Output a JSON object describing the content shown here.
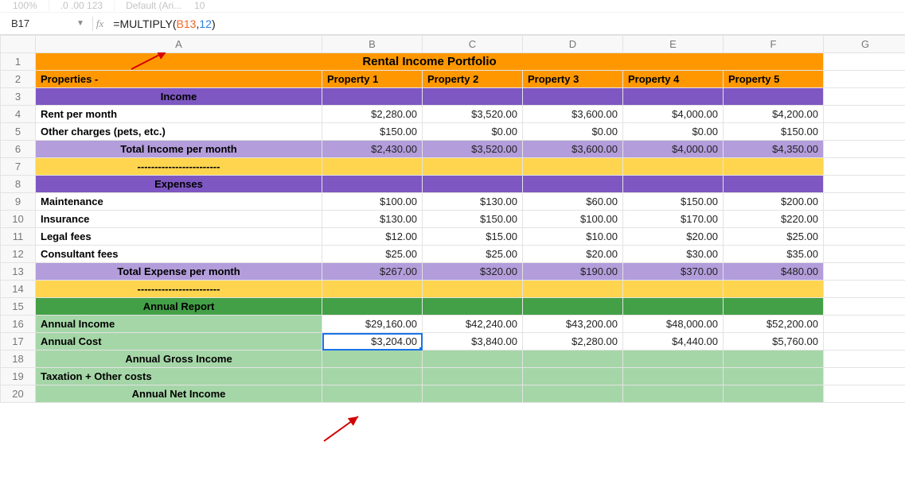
{
  "toolbar": {
    "zoom": "100%",
    "font": "Default (Ari...",
    "fontsize": "10",
    "format_hint": ".0 .00 123"
  },
  "namebox": "B17",
  "formula": {
    "prefix": "=",
    "fn": "MULTIPLY",
    "open": "(",
    "ref": "B13",
    "comma": ",",
    "num": "12",
    "close": ")"
  },
  "columns": [
    "A",
    "B",
    "C",
    "D",
    "E",
    "F",
    "G"
  ],
  "rows_count": 20,
  "data": {
    "title": "Rental Income Portfolio",
    "props_label": "Properties -",
    "props": [
      "Property 1",
      "Property 2",
      "Property 3",
      "Property 4",
      "Property 5"
    ],
    "income_hdr": "Income",
    "r4": {
      "label": "Rent per month",
      "v": [
        "$2,280.00",
        "$3,520.00",
        "$3,600.00",
        "$4,000.00",
        "$4,200.00"
      ]
    },
    "r5": {
      "label": "Other charges (pets, etc.)",
      "v": [
        "$150.00",
        "$0.00",
        "$0.00",
        "$0.00",
        "$150.00"
      ]
    },
    "r6": {
      "label": "Total Income per month",
      "v": [
        "$2,430.00",
        "$3,520.00",
        "$3,600.00",
        "$4,000.00",
        "$4,350.00"
      ]
    },
    "dashes": "------------------------",
    "expenses_hdr": "Expenses",
    "r9": {
      "label": "Maintenance",
      "v": [
        "$100.00",
        "$130.00",
        "$60.00",
        "$150.00",
        "$200.00"
      ]
    },
    "r10": {
      "label": "Insurance",
      "v": [
        "$130.00",
        "$150.00",
        "$100.00",
        "$170.00",
        "$220.00"
      ]
    },
    "r11": {
      "label": "Legal fees",
      "v": [
        "$12.00",
        "$15.00",
        "$10.00",
        "$20.00",
        "$25.00"
      ]
    },
    "r12": {
      "label": "Consultant fees",
      "v": [
        "$25.00",
        "$25.00",
        "$20.00",
        "$30.00",
        "$35.00"
      ]
    },
    "r13": {
      "label": "Total Expense per month",
      "v": [
        "$267.00",
        "$320.00",
        "$190.00",
        "$370.00",
        "$480.00"
      ]
    },
    "annual_hdr": "Annual Report",
    "r16": {
      "label": "Annual Income",
      "v": [
        "$29,160.00",
        "$42,240.00",
        "$43,200.00",
        "$48,000.00",
        "$52,200.00"
      ]
    },
    "r17": {
      "label": "Annual Cost",
      "v": [
        "$3,204.00",
        "$3,840.00",
        "$2,280.00",
        "$4,440.00",
        "$5,760.00"
      ]
    },
    "r18": {
      "label": "Annual Gross Income"
    },
    "r19": {
      "label": "Taxation + Other costs"
    },
    "r20": {
      "label": "Annual Net Income"
    }
  },
  "active_cell": "B17",
  "chart_data": {
    "type": "table",
    "title": "Rental Income Portfolio",
    "categories": [
      "Property 1",
      "Property 2",
      "Property 3",
      "Property 4",
      "Property 5"
    ],
    "series": [
      {
        "name": "Rent per month",
        "values": [
          2280,
          3520,
          3600,
          4000,
          4200
        ]
      },
      {
        "name": "Other charges (pets, etc.)",
        "values": [
          150,
          0,
          0,
          0,
          150
        ]
      },
      {
        "name": "Total Income per month",
        "values": [
          2430,
          3520,
          3600,
          4000,
          4350
        ]
      },
      {
        "name": "Maintenance",
        "values": [
          100,
          130,
          60,
          150,
          200
        ]
      },
      {
        "name": "Insurance",
        "values": [
          130,
          150,
          100,
          170,
          220
        ]
      },
      {
        "name": "Legal fees",
        "values": [
          12,
          15,
          10,
          20,
          25
        ]
      },
      {
        "name": "Consultant fees",
        "values": [
          25,
          25,
          20,
          30,
          35
        ]
      },
      {
        "name": "Total Expense per month",
        "values": [
          267,
          320,
          190,
          370,
          480
        ]
      },
      {
        "name": "Annual Income",
        "values": [
          29160,
          42240,
          43200,
          48000,
          52200
        ]
      },
      {
        "name": "Annual Cost",
        "values": [
          3204,
          3840,
          2280,
          4440,
          5760
        ]
      }
    ]
  }
}
